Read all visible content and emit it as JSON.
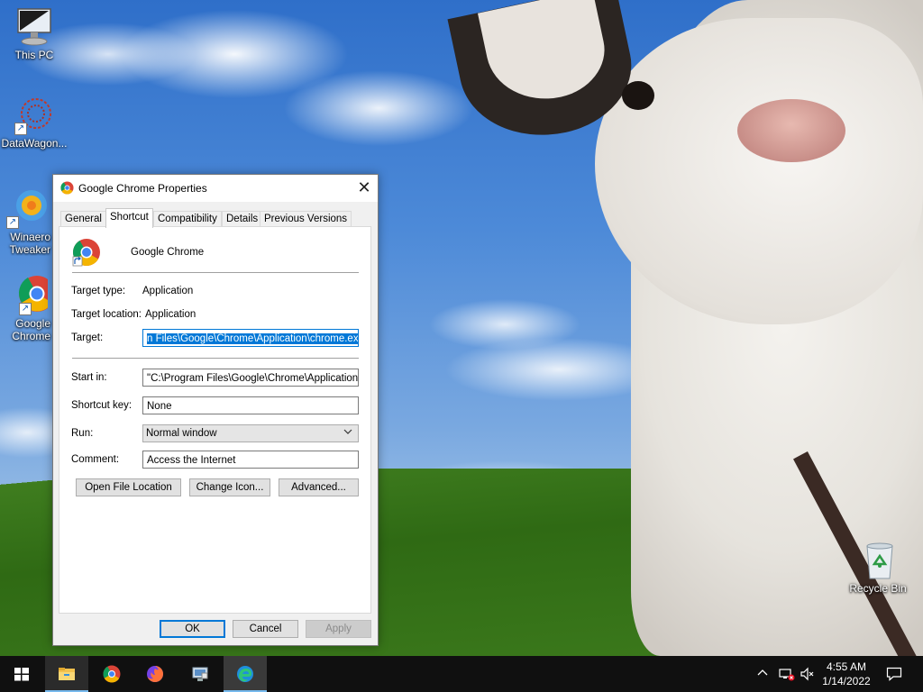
{
  "desktop": {
    "icons": [
      {
        "label": "This PC"
      },
      {
        "label": "DataWagon..."
      },
      {
        "label": "Winaero Tweaker"
      },
      {
        "label": "Google Chrome"
      },
      {
        "label": "Recycle Bin"
      }
    ]
  },
  "dialog": {
    "title": "Google Chrome Properties",
    "close_glyph": "✕",
    "tabs": [
      "General",
      "Shortcut",
      "Compatibility",
      "Details",
      "Previous Versions"
    ],
    "active_tab": "Shortcut",
    "app_name": "Google Chrome",
    "target_type_label": "Target type:",
    "target_type_value": "Application",
    "target_location_label": "Target location:",
    "target_location_value": "Application",
    "target_label": "Target:",
    "target_value": "n Files\\Google\\Chrome\\Application\\chrome.exe\"",
    "start_in_label": "Start in:",
    "start_in_value": "\"C:\\Program Files\\Google\\Chrome\\Application\"",
    "shortcut_key_label": "Shortcut key:",
    "shortcut_key_value": "None",
    "run_label": "Run:",
    "run_value": "Normal window",
    "comment_label": "Comment:",
    "comment_value": "Access the Internet",
    "buttons": {
      "open_file_location": "Open File Location",
      "change_icon": "Change Icon...",
      "advanced": "Advanced...",
      "ok": "OK",
      "cancel": "Cancel",
      "apply": "Apply"
    }
  },
  "taskbar": {
    "apps": [
      "start-icon",
      "file-explorer-icon",
      "chrome-icon",
      "firefox-icon",
      "control-panel-icon",
      "edge-icon"
    ],
    "clock_time": "4:55 AM",
    "clock_date": "1/14/2022"
  },
  "colors": {
    "accent": "#0078d7",
    "taskbar": "#101010",
    "dialog_bg": "#f0f0f0"
  }
}
